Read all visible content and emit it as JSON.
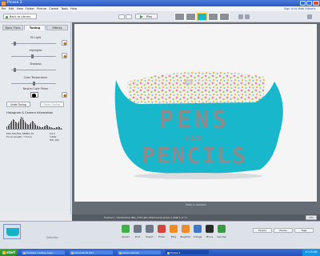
{
  "window": {
    "title": "Picasa 3"
  },
  "menu": {
    "items": [
      "File",
      "Edit",
      "View",
      "Folder",
      "Picture",
      "Create",
      "Tools",
      "Help"
    ],
    "sign_in": "Sign In to Web Albums"
  },
  "toolbar": {
    "back_label": "Back to Library",
    "play_label": "Play"
  },
  "panel": {
    "tabs": [
      "Basic Fixes",
      "Tuning",
      "Effects"
    ],
    "sliders": [
      {
        "label": "Fill Light",
        "value": 0.05
      },
      {
        "label": "Highlights",
        "value": 0.48
      },
      {
        "label": "Shadows",
        "value": 0.05
      },
      {
        "label": "Color Temperature",
        "value": 0.5
      }
    ],
    "neutral_label": "Neutral Color Picker",
    "auto_button": "Undo Tuning",
    "redo_button": "Redo Tuning",
    "histogram_title": "Histogram & Camera Information",
    "camera_model": "EOS DIGITAL REBEL XS",
    "focal_length": "Focal Length: 7.5mm",
    "aperture": "f/4.0",
    "shutter": "1/60s",
    "iso": "ISO 100"
  },
  "photo": {
    "text_line1": "PENS",
    "text_and": "AND",
    "text_line2": "PENCILS",
    "bag_color": "#19b7cb",
    "lettering_color": "#8b8b8b"
  },
  "canvas": {
    "caption": "Make a caption!"
  },
  "infobar": {
    "text": "finished • 03/24/2010     IMG_2357.JPG   2592x1944 pixels   2.5MB   1 of 71"
  },
  "strip_buttons": [
    "People",
    "Places",
    "Tags",
    "Info"
  ],
  "tray": {
    "selection_label": "Selection",
    "actions": [
      "Upload",
      "Print",
      "Export",
      "Email",
      "Blog",
      "BlogThis!",
      "Collage",
      "Movie",
      "Geo-Tag"
    ]
  },
  "taskbar": {
    "start": "start",
    "tasks": [
      "Problem loading page...",
      "2010-03-25 001",
      "photo tutorial",
      "Picasa 3"
    ],
    "clock": "10:16 AM"
  }
}
